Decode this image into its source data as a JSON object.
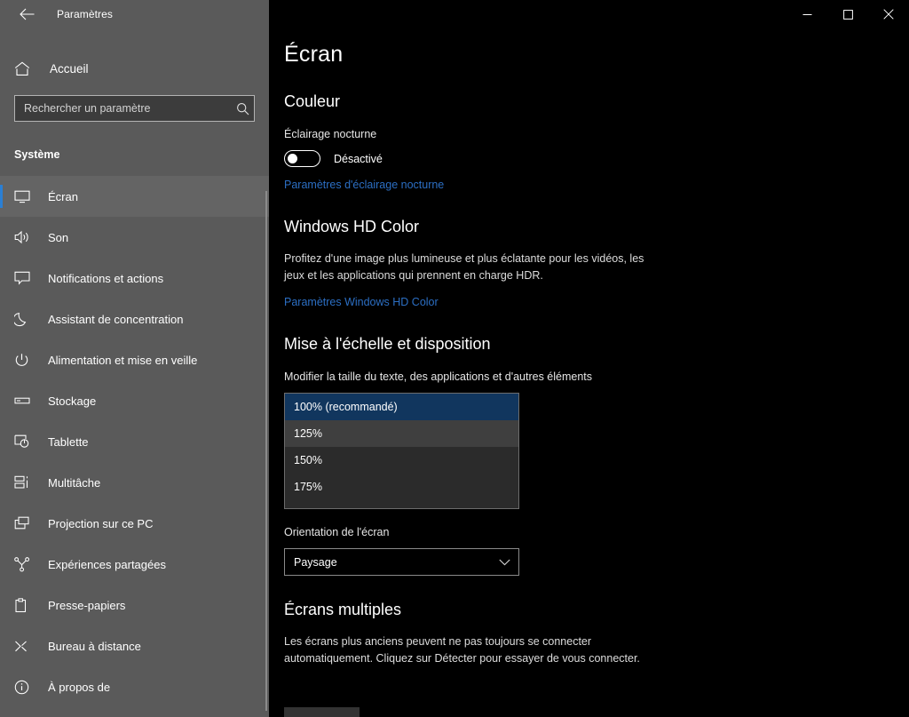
{
  "window": {
    "title": "Paramètres",
    "back_icon": "arrow-left-icon",
    "controls": {
      "minimize": "–",
      "maximize": "□",
      "close": "✕"
    }
  },
  "sidebar": {
    "home": {
      "label": "Accueil",
      "icon": "home-icon"
    },
    "search": {
      "placeholder": "Rechercher un paramètre",
      "value": "",
      "icon": "search-icon"
    },
    "group_title": "Système",
    "items": [
      {
        "label": "Écran",
        "icon": "monitor-icon",
        "selected": true
      },
      {
        "label": "Son",
        "icon": "speaker-icon",
        "selected": false
      },
      {
        "label": "Notifications et actions",
        "icon": "notification-icon",
        "selected": false
      },
      {
        "label": "Assistant de concentration",
        "icon": "moon-icon",
        "selected": false
      },
      {
        "label": "Alimentation et mise en veille",
        "icon": "power-icon",
        "selected": false
      },
      {
        "label": "Stockage",
        "icon": "storage-icon",
        "selected": false
      },
      {
        "label": "Tablette",
        "icon": "tablet-icon",
        "selected": false
      },
      {
        "label": "Multitâche",
        "icon": "multitask-icon",
        "selected": false
      },
      {
        "label": "Projection sur ce PC",
        "icon": "projection-icon",
        "selected": false
      },
      {
        "label": "Expériences partagées",
        "icon": "share-icon",
        "selected": false
      },
      {
        "label": "Presse-papiers",
        "icon": "clipboard-icon",
        "selected": false
      },
      {
        "label": "Bureau à distance",
        "icon": "remote-desktop-icon",
        "selected": false
      },
      {
        "label": "À propos de",
        "icon": "info-icon",
        "selected": false
      }
    ]
  },
  "main": {
    "page_title": "Écran",
    "color_section": {
      "heading": "Couleur",
      "night_light_label": "Éclairage nocturne",
      "night_light_state": "Désactivé",
      "night_light_on": false,
      "link": "Paramètres d'éclairage nocturne"
    },
    "hd_color_section": {
      "heading": "Windows HD Color",
      "description": "Profitez d'une image plus lumineuse et plus éclatante pour les vidéos, les jeux et les applications qui prennent en charge HDR.",
      "link": "Paramètres Windows HD Color"
    },
    "scale_section": {
      "heading": "Mise à l'échelle et disposition",
      "scale_label": "Modifier la taille du texte, des applications et d'autres éléments",
      "scale_options": [
        {
          "label": "100% (recommandé)",
          "state": "selected"
        },
        {
          "label": "125%",
          "state": "hover"
        },
        {
          "label": "150%",
          "state": "normal"
        },
        {
          "label": "175%",
          "state": "normal"
        }
      ],
      "orientation_label": "Orientation de l'écran",
      "orientation_value": "Paysage"
    },
    "multi_display_section": {
      "heading": "Écrans multiples",
      "description": "Les écrans plus anciens peuvent ne pas toujours se connecter automatiquement. Cliquez sur Détecter pour essayer de vous connecter."
    }
  },
  "colors": {
    "accent": "#2a7fd4",
    "link": "#2c6fc4",
    "sidebar_bg": "#5a5a5a",
    "content_bg": "#000000",
    "selected_row": "#11365e",
    "hover_row": "#3f3f3f"
  }
}
